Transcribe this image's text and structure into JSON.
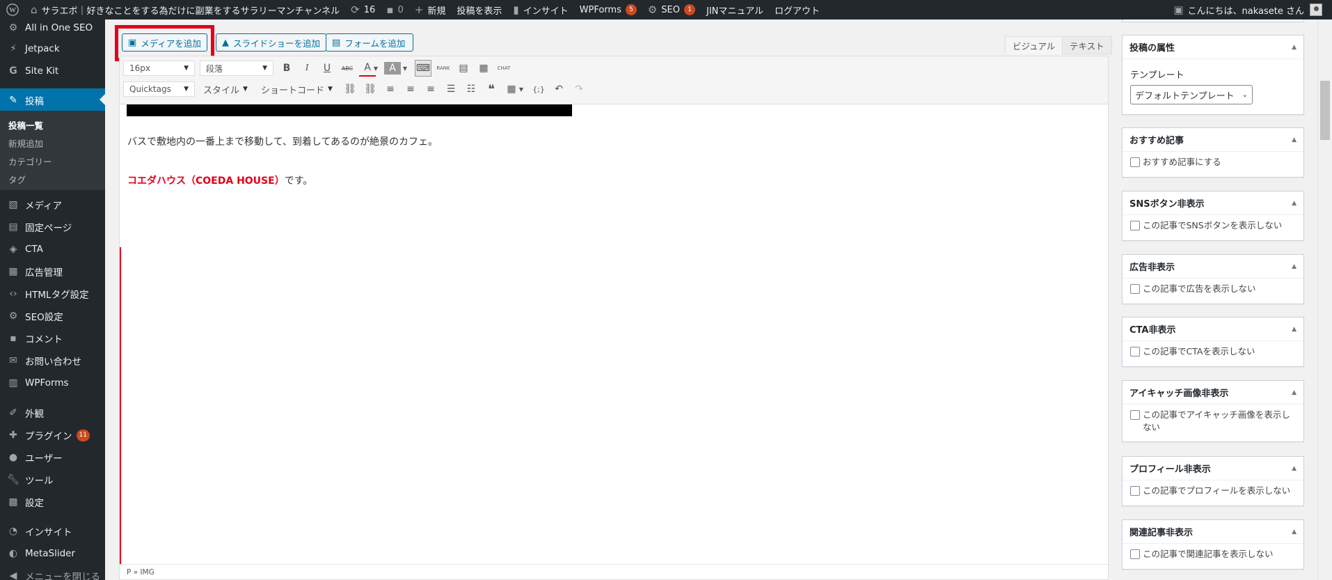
{
  "admin_bar": {
    "site_title": "サラエボ｜好きなことをする為だけに副業をするサラリーマンチャンネル",
    "updates_count": "16",
    "comments_count": "0",
    "new_label": "新規",
    "view_post": "投稿を表示",
    "insights": "インサイト",
    "wpforms": "WPForms",
    "wpforms_badge": "5",
    "seo": "SEO",
    "seo_badge": "1",
    "jin_manual": "JINマニュアル",
    "logout": "ログアウト",
    "greeting": "こんにちは、nakasete さん"
  },
  "sidebar": {
    "items": [
      {
        "label": "All in One SEO",
        "icon": "gear-icon"
      },
      {
        "label": "Jetpack",
        "icon": "jetpack-icon"
      },
      {
        "label": "Site Kit",
        "icon": "google-icon"
      },
      {
        "label": "投稿",
        "icon": "pin-icon"
      },
      {
        "label": "メディア",
        "icon": "media-icon"
      },
      {
        "label": "固定ページ",
        "icon": "page-icon"
      },
      {
        "label": "CTA",
        "icon": "tag-icon"
      },
      {
        "label": "広告管理",
        "icon": "ad-icon"
      },
      {
        "label": "HTMLタグ設定",
        "icon": "code-icon"
      },
      {
        "label": "SEO設定",
        "icon": "gear-icon"
      },
      {
        "label": "コメント",
        "icon": "comment-icon"
      },
      {
        "label": "お問い合わせ",
        "icon": "mail-icon"
      },
      {
        "label": "WPForms",
        "icon": "form-icon"
      },
      {
        "label": "外観",
        "icon": "brush-icon"
      },
      {
        "label": "プラグイン",
        "icon": "plugin-icon",
        "badge": "11"
      },
      {
        "label": "ユーザー",
        "icon": "user-icon"
      },
      {
        "label": "ツール",
        "icon": "wrench-icon"
      },
      {
        "label": "設定",
        "icon": "settings-icon"
      },
      {
        "label": "インサイト",
        "icon": "insights-icon"
      },
      {
        "label": "MetaSlider",
        "icon": "slider-icon"
      },
      {
        "label": "メニューを閉じる",
        "icon": "collapse-icon"
      }
    ],
    "submenu": [
      "投稿一覧",
      "新規追加",
      "カテゴリー",
      "タグ"
    ]
  },
  "editor": {
    "add_media": "メディアを追加",
    "add_slideshow": "スライドショーを追加",
    "add_form": "フォームを追加",
    "tab_visual": "ビジュアル",
    "tab_text": "テキスト",
    "font_size": "16px",
    "format": "段落",
    "quicktags": "Quicktags",
    "style": "スタイル",
    "shortcode": "ショートコード",
    "paragraph_1": "バスで敷地内の一番上まで移動して、到着してあるのが絶景のカフェ。",
    "paragraph_2_strong": "コエダハウス（COEDA HOUSE）",
    "paragraph_2_rest": "です。",
    "path": "P » IMG"
  },
  "metaboxes": {
    "attributes": {
      "title": "投稿の属性",
      "template_label": "テンプレート",
      "template_value": "デフォルトテンプレート"
    },
    "boxes": [
      {
        "title": "おすすめ記事",
        "checkbox": "おすすめ記事にする"
      },
      {
        "title": "SNSボタン非表示",
        "checkbox": "この記事でSNSボタンを表示しない"
      },
      {
        "title": "広告非表示",
        "checkbox": "この記事で広告を表示しない"
      },
      {
        "title": "CTA非表示",
        "checkbox": "この記事でCTAを表示しない"
      },
      {
        "title": "アイキャッチ画像非表示",
        "checkbox": "この記事でアイキャッチ画像を表示しない"
      },
      {
        "title": "プロフィール非表示",
        "checkbox": "この記事でプロフィールを表示しない"
      },
      {
        "title": "関連記事非表示",
        "checkbox": "この記事で関連記事を表示しない"
      }
    ]
  },
  "colors": {
    "admin_bar": "#23282d",
    "current_menu": "#0073aa",
    "highlight": "#e2001a",
    "badge": "#ca4a1f"
  }
}
